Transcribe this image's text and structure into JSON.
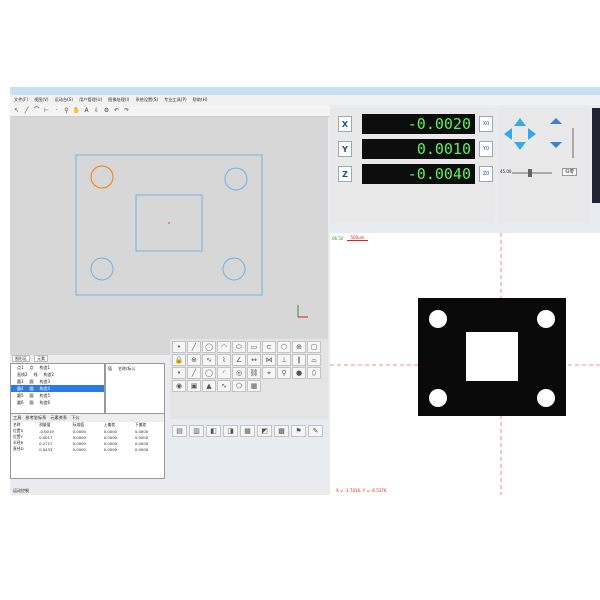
{
  "menu": [
    "文件(F)",
    "视图(V)",
    "运动台(S)",
    "用户管理(U)",
    "图像处理(I)",
    "系统设置(S)",
    "专业工具(P)",
    "帮助(H)"
  ],
  "toolbar_icons": [
    "select-icon",
    "line-icon",
    "arc-icon",
    "measure-icon",
    "point-icon",
    "zoom-icon",
    "hand-icon",
    "text-icon",
    "export-icon",
    "settings-icon"
  ],
  "dro": {
    "x_label": "X",
    "x_value": "-0.0020",
    "x_zero": "X0",
    "y_label": "Y",
    "y_value": "0.0010",
    "y_zero": "Y0",
    "z_label": "Z",
    "z_value": "-0.0040",
    "z_zero": "Z0"
  },
  "motion": {
    "speed_value": "45.00",
    "home_button": "归零"
  },
  "camera": {
    "lens_label": "06.50",
    "scale_label": "500um",
    "coord_readout": "X = -1.7016, Y = -6.5376"
  },
  "cad_tabs": [
    "图形区",
    "元素"
  ],
  "element_list": {
    "rows": [
      {
        "id": "点1",
        "type": "点",
        "name": "构造1"
      },
      {
        "id": "直线2",
        "type": "线",
        "name": "构造2"
      },
      {
        "id": "圆3",
        "type": "圆",
        "name": "构造3"
      },
      {
        "id": "圆4",
        "type": "圆",
        "name": "构造4"
      },
      {
        "id": "圆5",
        "type": "圆",
        "name": "构造5"
      },
      {
        "id": "圆6",
        "type": "圆",
        "name": "构造6"
      },
      {
        "id": "矩形7",
        "type": "矩",
        "name": "构造7"
      },
      {
        "id": "直线8",
        "type": "线",
        "name": "构造8"
      }
    ],
    "selected_index": 3
  },
  "props": {
    "col1": "值",
    "col2": "名称/标公"
  },
  "coord_panel": {
    "tabs": [
      "工具",
      "参考坐标系",
      "元素关系",
      "下公"
    ],
    "headers": [
      "名称",
      "测量值",
      "标准值",
      "上偏差",
      "下偏差"
    ],
    "rows": [
      [
        "位置X",
        "-0.0019",
        "0.0000",
        "0.0000",
        "0.0000"
      ],
      [
        "位置Y",
        "0.0017",
        "0.0000",
        "0.0000",
        "0.0000"
      ],
      [
        "半径R",
        "0.2717",
        "0.0000",
        "0.0000",
        "0.0000"
      ],
      [
        "直径D",
        "0.5433",
        "0.0000",
        "0.0000",
        "0.0000"
      ]
    ]
  },
  "status": "运动控制"
}
